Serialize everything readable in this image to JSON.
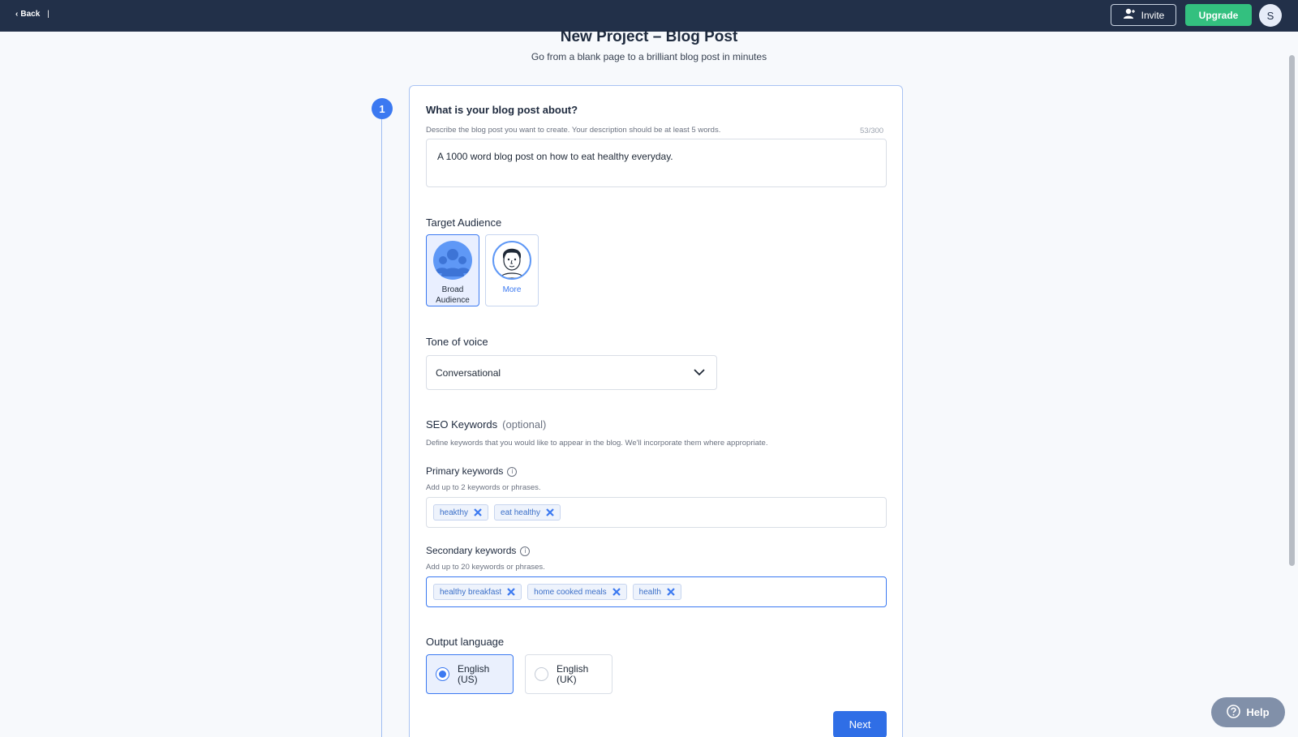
{
  "topbar": {
    "back_label": "Back",
    "separator": "|",
    "invite_label": "Invite",
    "upgrade_label": "Upgrade",
    "avatar_initial": "S"
  },
  "header": {
    "title": "New Project – Blog Post",
    "subtitle": "Go from a blank page to a brilliant blog post in minutes"
  },
  "step": {
    "number": "1"
  },
  "about": {
    "label": "What is your blog post about?",
    "hint": "Describe the blog post you want to create. Your description should be at least 5 words.",
    "counter": "53/300",
    "value": "A 1000 word blog post on how to eat healthy everyday."
  },
  "audience": {
    "label": "Target Audience",
    "options": [
      {
        "label": "Broad Audience",
        "selected": true
      },
      {
        "label": "More",
        "selected": false
      }
    ]
  },
  "tone": {
    "label": "Tone of voice",
    "selected": "Conversational"
  },
  "seo": {
    "label": "SEO Keywords",
    "optional": "(optional)",
    "hint": "Define keywords that you would like to appear in the blog. We'll incorporate them where appropriate.",
    "primary": {
      "label": "Primary keywords",
      "hint": "Add up to 2 keywords or phrases.",
      "tags": [
        "heakthy",
        "eat healthy"
      ]
    },
    "secondary": {
      "label": "Secondary keywords",
      "hint": "Add up to 20 keywords or phrases.",
      "tags": [
        "healthy breakfast",
        "home cooked meals",
        "health"
      ]
    }
  },
  "language": {
    "label": "Output language",
    "options": [
      {
        "line1": "English",
        "line2": "(US)",
        "selected": true
      },
      {
        "line1": "English",
        "line2": "(UK)",
        "selected": false
      }
    ]
  },
  "actions": {
    "next_label": "Next"
  },
  "help": {
    "label": "Help"
  },
  "colors": {
    "topbar": "#223049",
    "accent": "#3b79f1",
    "upgrade": "#33c07f",
    "help": "#8190a9"
  },
  "icons": {
    "back": "chevron-left-icon",
    "invite": "user-plus-icon",
    "tone_dropdown": "chevron-down-icon",
    "info": "info-icon",
    "tag_remove": "close-icon",
    "help": "question-circle-icon"
  }
}
